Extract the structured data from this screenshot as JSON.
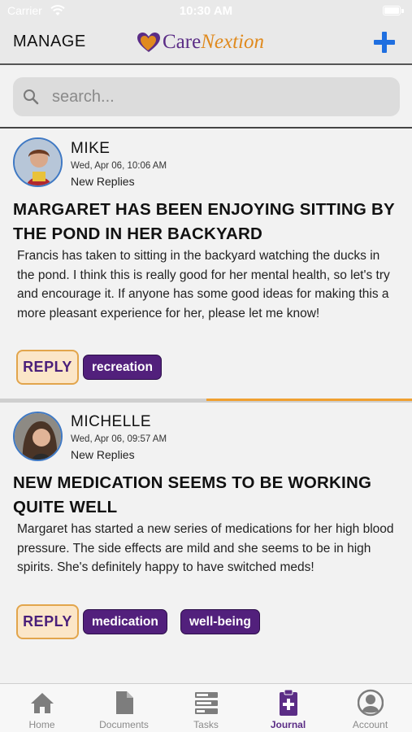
{
  "status_bar": {
    "carrier": "Carrier",
    "time": "10:30 AM"
  },
  "nav": {
    "left_label": "MANAGE",
    "logo_care": "Care",
    "logo_nextion": "Nextion"
  },
  "search": {
    "placeholder": "search..."
  },
  "posts": [
    {
      "author": "MIKE",
      "date": "Wed, Apr 06, 10:06 AM",
      "status": "New Replies",
      "title": "MARGARET HAS BEEN ENJOYING SITTING BY THE POND IN HER BACKYARD",
      "body": "Francis has taken to sitting in the backyard watching the ducks in the pond. I think this is really good for her mental health, so let's try and encourage it. If anyone has some good ideas for making this a more pleasant experience for her, please let me know!",
      "reply_label": "REPLY",
      "tags": [
        "recreation"
      ]
    },
    {
      "author": "MICHELLE",
      "date": "Wed, Apr 06, 09:57 AM",
      "status": "New Replies",
      "title": "NEW MEDICATION SEEMS TO BE WORKING QUITE WELL",
      "body": "Margaret has started a new series of medications for her high blood pressure. The side effects are mild and she seems to be in high spirits. She's definitely happy to have switched meds!",
      "reply_label": "REPLY",
      "tags": [
        "medication",
        "well-being"
      ]
    }
  ],
  "tabs": [
    {
      "label": "Home",
      "icon": "home-icon",
      "active": false
    },
    {
      "label": "Documents",
      "icon": "document-icon",
      "active": false
    },
    {
      "label": "Tasks",
      "icon": "tasks-icon",
      "active": false
    },
    {
      "label": "Journal",
      "icon": "journal-icon",
      "active": true
    },
    {
      "label": "Account",
      "icon": "account-icon",
      "active": false
    }
  ],
  "colors": {
    "brand_purple": "#52207c",
    "brand_orange": "#e08a1e",
    "add_blue": "#1f6fe0"
  }
}
